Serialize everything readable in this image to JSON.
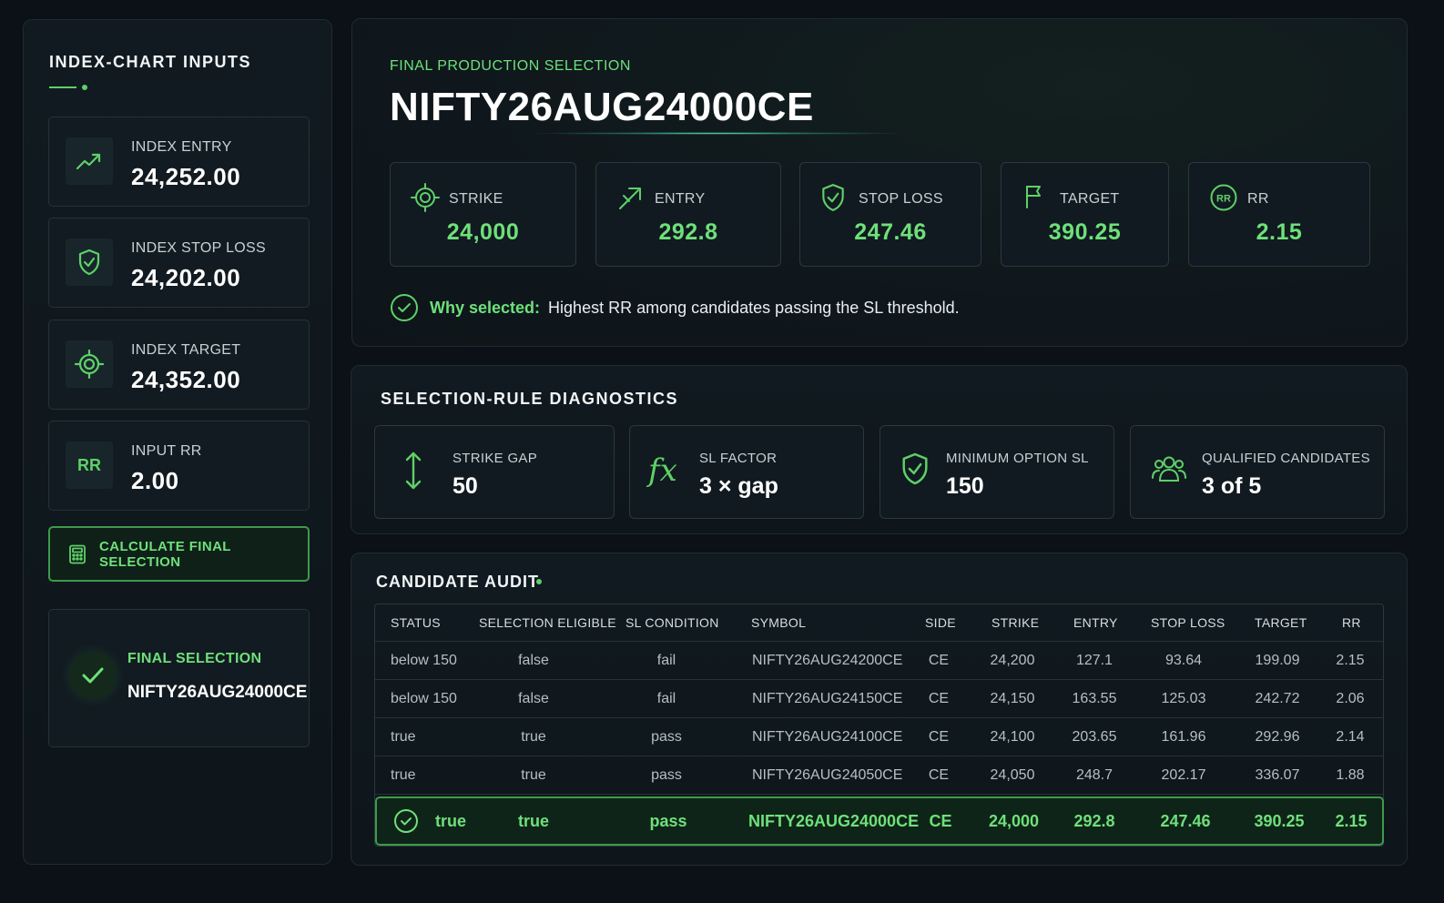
{
  "sidebar": {
    "title": "INDEX-CHART INPUTS",
    "inputs": [
      {
        "label": "INDEX ENTRY",
        "value": "24,252.00",
        "icon": "trend-up-icon"
      },
      {
        "label": "INDEX STOP LOSS",
        "value": "24,202.00",
        "icon": "shield-check-icon"
      },
      {
        "label": "INDEX TARGET",
        "value": "24,352.00",
        "icon": "crosshair-icon"
      },
      {
        "label": "INPUT RR",
        "value": "2.00",
        "icon": "rr-text-icon",
        "icon_text": "RR"
      }
    ],
    "calculate_label": "CALCULATE FINAL SELECTION",
    "final": {
      "label": "FINAL SELECTION",
      "value": "NIFTY26AUG24000CE"
    }
  },
  "production": {
    "eyebrow": "FINAL PRODUCTION SELECTION",
    "symbol": "NIFTY26AUG24000CE",
    "metrics": [
      {
        "label": "STRIKE",
        "value": "24,000",
        "icon": "crosshair-icon"
      },
      {
        "label": "ENTRY",
        "value": "292.8",
        "icon": "arrow-entry-icon"
      },
      {
        "label": "STOP LOSS",
        "value": "247.46",
        "icon": "shield-check-icon"
      },
      {
        "label": "TARGET",
        "value": "390.25",
        "icon": "flag-icon"
      },
      {
        "label": "RR",
        "value": "2.15",
        "icon": "rr-circle-icon",
        "icon_text": "RR"
      }
    ],
    "why_label": "Why selected:",
    "why_text": "Highest RR among candidates passing the SL threshold."
  },
  "diagnostics": {
    "title": "SELECTION-RULE DIAGNOSTICS",
    "cards": [
      {
        "label": "STRIKE GAP",
        "value": "50",
        "icon": "vertical-arrows-icon"
      },
      {
        "label": "SL FACTOR",
        "value": "3 × gap",
        "icon": "fx-icon",
        "icon_text": "fx"
      },
      {
        "label": "MINIMUM OPTION SL",
        "value": "150",
        "icon": "shield-check-icon"
      },
      {
        "label": "QUALIFIED CANDIDATES",
        "value": "3 of 5",
        "icon": "users-icon"
      }
    ]
  },
  "audit": {
    "title": "CANDIDATE AUDIT",
    "columns": [
      "STATUS",
      "SELECTION ELIGIBLE",
      "SL CONDITION",
      "SYMBOL",
      "SIDE",
      "STRIKE",
      "ENTRY",
      "STOP LOSS",
      "TARGET",
      "RR"
    ],
    "rows": [
      [
        "below 150",
        "false",
        "fail",
        "NIFTY26AUG24200CE",
        "CE",
        "24,200",
        "127.1",
        "93.64",
        "199.09",
        "2.15"
      ],
      [
        "below 150",
        "false",
        "fail",
        "NIFTY26AUG24150CE",
        "CE",
        "24,150",
        "163.55",
        "125.03",
        "242.72",
        "2.06"
      ],
      [
        "true",
        "true",
        "pass",
        "NIFTY26AUG24100CE",
        "CE",
        "24,100",
        "203.65",
        "161.96",
        "292.96",
        "2.14"
      ],
      [
        "true",
        "true",
        "pass",
        "NIFTY26AUG24050CE",
        "CE",
        "24,050",
        "248.7",
        "202.17",
        "336.07",
        "1.88"
      ]
    ],
    "selected_row": [
      "true",
      "true",
      "pass",
      "NIFTY26AUG24000CE",
      "CE",
      "24,000",
      "292.8",
      "247.46",
      "390.25",
      "2.15"
    ]
  },
  "colors": {
    "accent": "#5fd068",
    "accent_bright": "#6ee07a",
    "background": "#0b1116",
    "panel": "#111a20"
  }
}
